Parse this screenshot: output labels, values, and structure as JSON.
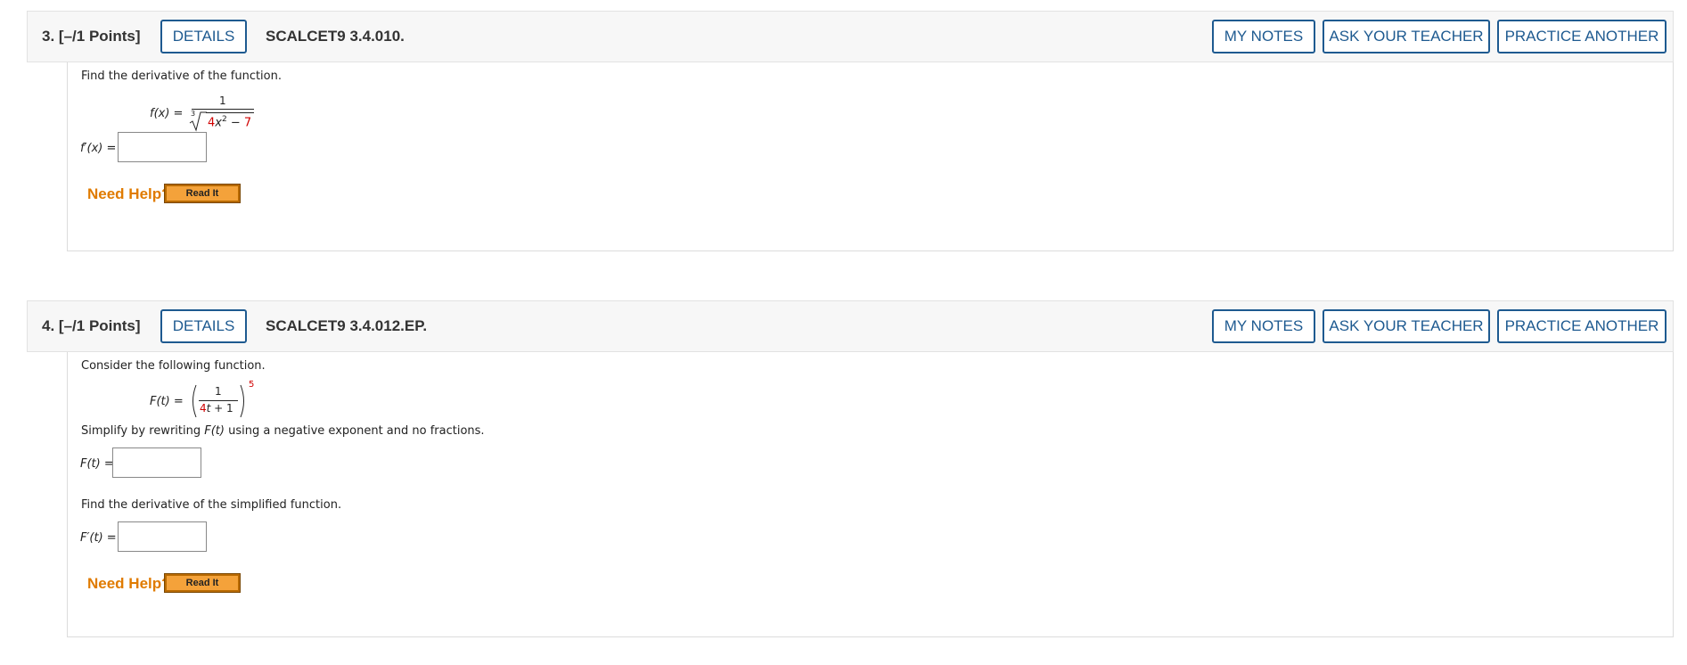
{
  "questions": [
    {
      "number": "3.",
      "points": "[–/1 Points]",
      "details_label": "DETAILS",
      "code": "SCALCET9 3.4.010.",
      "my_notes_label": "MY NOTES",
      "ask_teacher_label": "ASK YOUR TEACHER",
      "practice_label": "PRACTICE ANOTHER",
      "prompt": "Find the derivative of the function.",
      "function_lhs": "f(x) =",
      "numerator": "1",
      "root_index": "3",
      "radicand_coef": "4",
      "radicand_var": "x",
      "radicand_exp": "2",
      "radicand_op": "−",
      "radicand_const": "7",
      "answer_label": "f′(x) =",
      "answer_value": "",
      "need_help": "Need Help?",
      "read_it": "Read It"
    },
    {
      "number": "4.",
      "points": "[–/1 Points]",
      "details_label": "DETAILS",
      "code": "SCALCET9 3.4.012.EP.",
      "my_notes_label": "MY NOTES",
      "ask_teacher_label": "ASK YOUR TEACHER",
      "practice_label": "PRACTICE ANOTHER",
      "prompt": "Consider the following function.",
      "function_lhs": "F(t) =",
      "numerator": "1",
      "denominator_coef": "4",
      "denominator_var": "t",
      "denominator_rest": " + 1",
      "exponent": "5",
      "simplify_prefix": "Simplify by rewriting ",
      "simplify_func": "F(t)",
      "simplify_suffix": " using a negative exponent and no fractions.",
      "simplify_label": "F(t) =",
      "simplify_value": "",
      "derivative_prompt": "Find the derivative of the simplified function.",
      "answer_label": "F′(t) =",
      "answer_value": "",
      "need_help": "Need Help?",
      "read_it": "Read It"
    }
  ],
  "colors": {
    "button_border": "#1e5a90",
    "need_help": "#e07b00",
    "read_it_bg": "#f4a23a",
    "highlight_red": "#d00000",
    "header_bg": "#f7f7f7"
  }
}
